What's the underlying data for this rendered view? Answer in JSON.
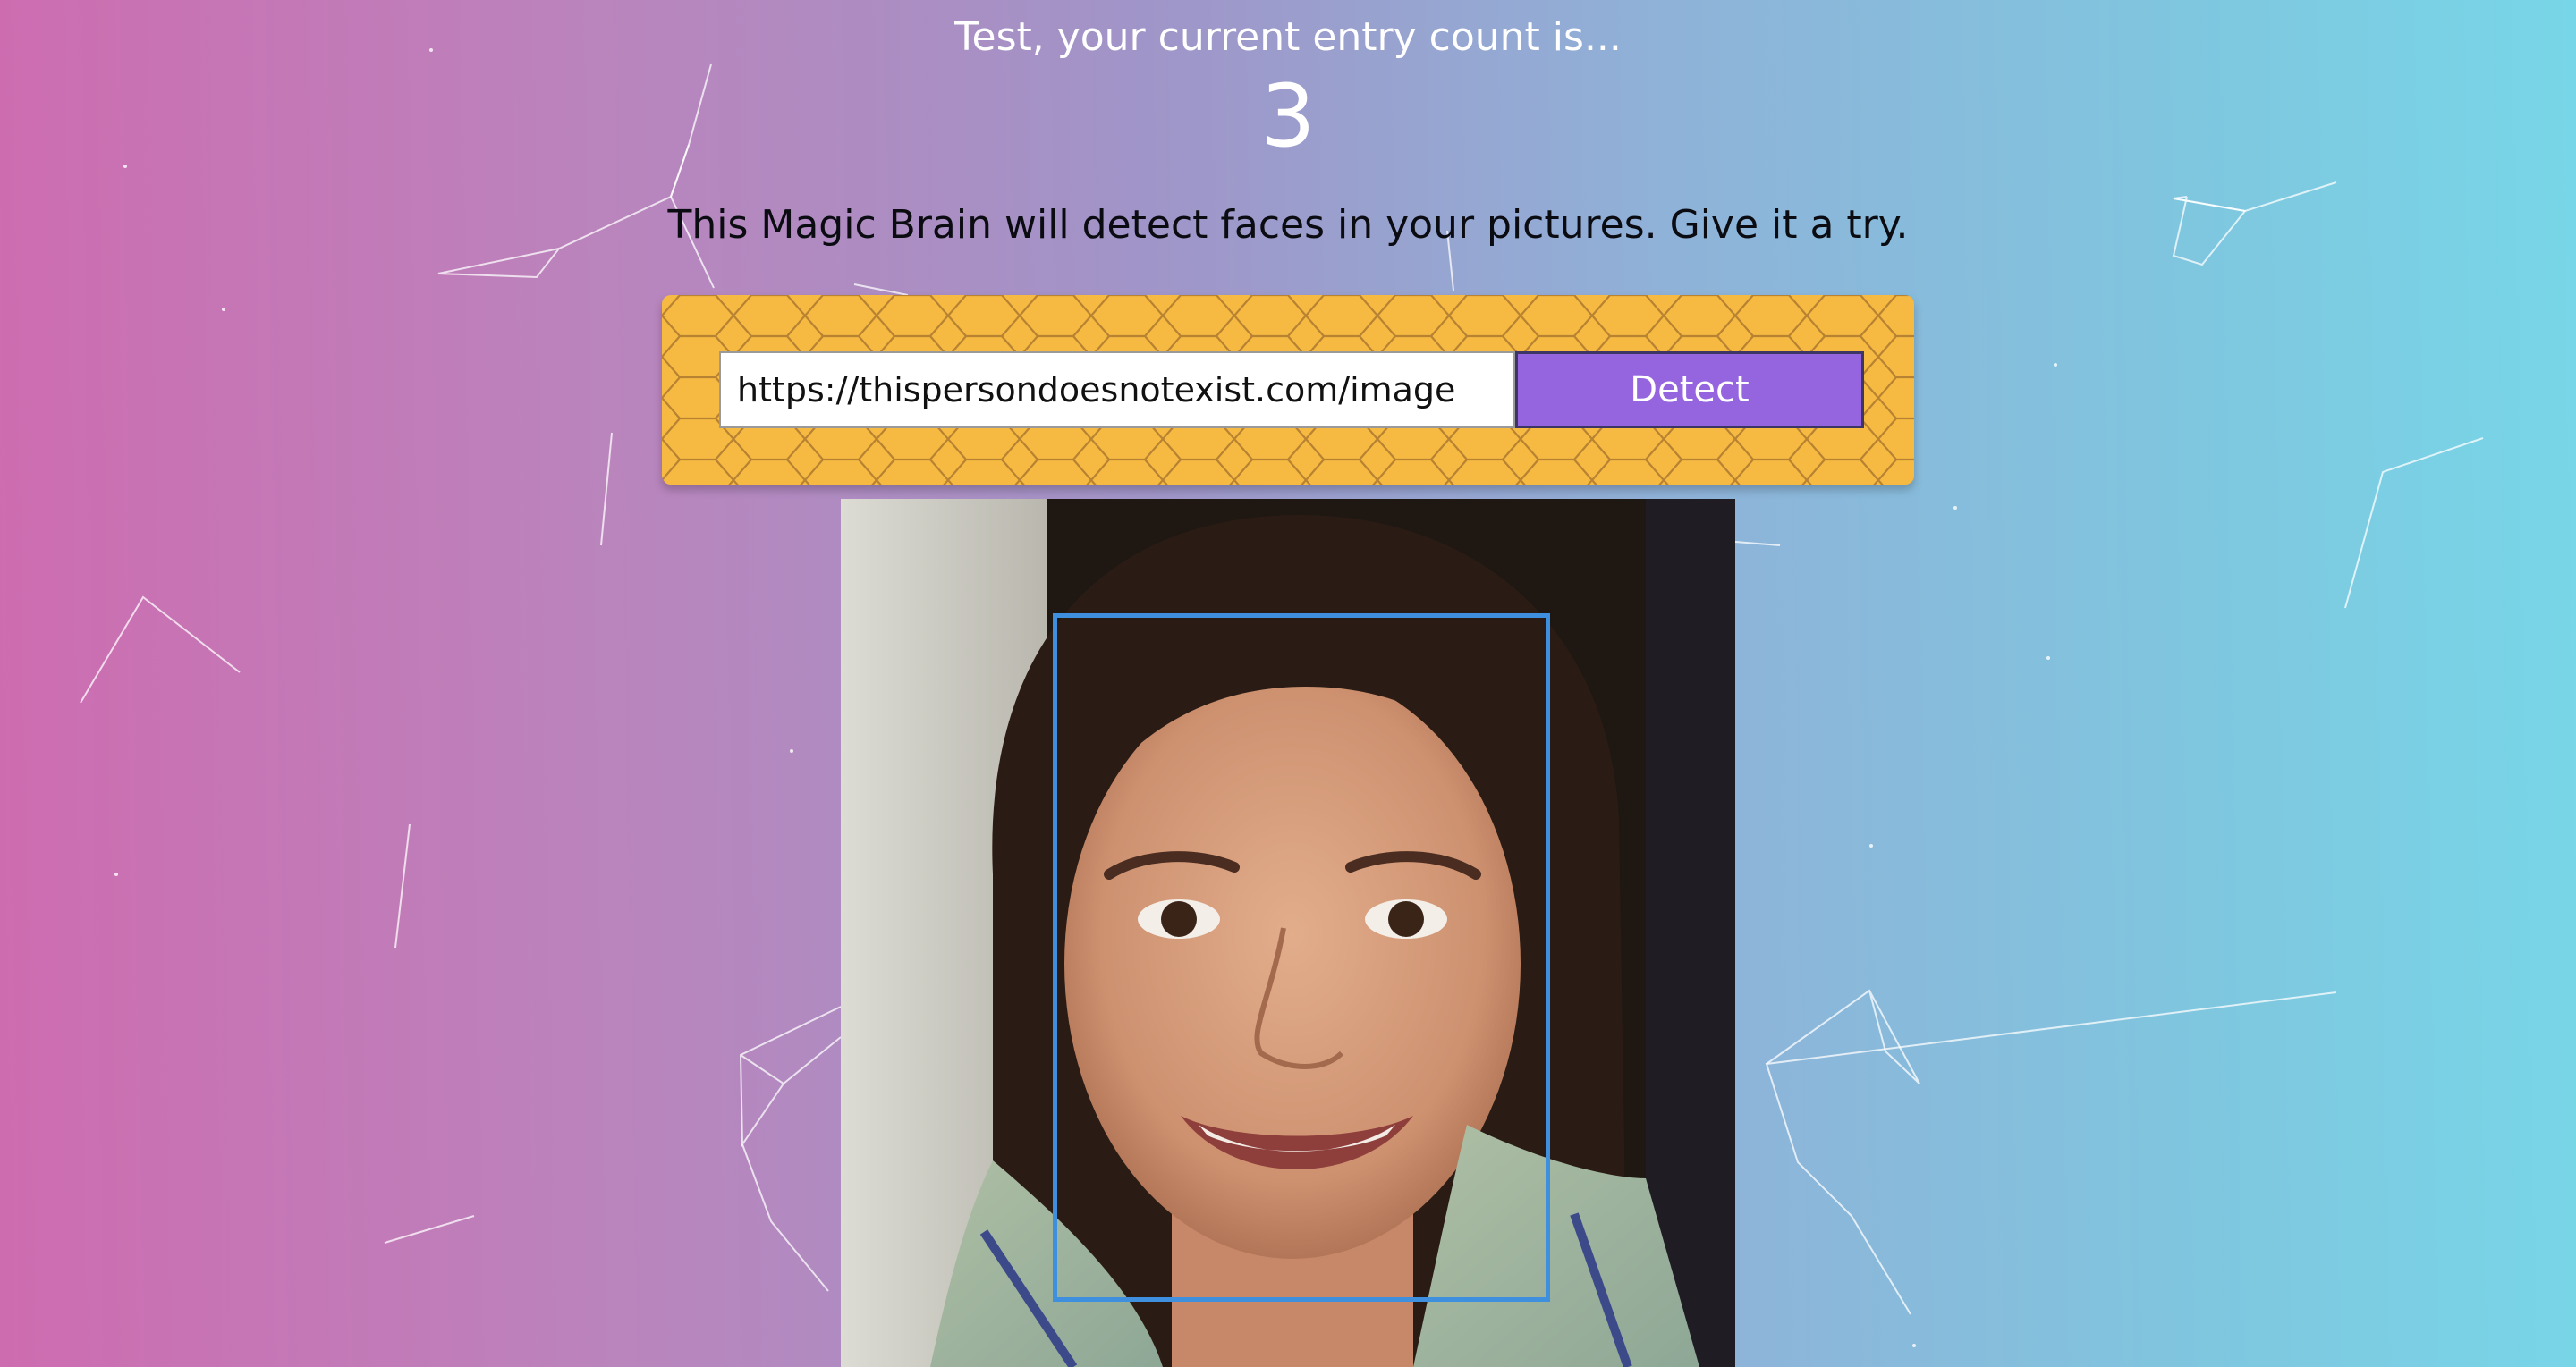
{
  "header": {
    "greeting": "Test, your current entry count is...",
    "entry_count": "3"
  },
  "tagline": "This Magic Brain will detect faces in your pictures. Give it a try.",
  "form": {
    "url_value": "https://thispersondoesnotexist.com/image",
    "detect_label": "Detect"
  },
  "result": {
    "faces_detected": 1
  },
  "colors": {
    "panel_background": "#f6b942",
    "button_background": "#9565e0",
    "face_box_border": "#3f8fdf",
    "gradient_left": "#ce6cb0",
    "gradient_right": "#77d6e7"
  }
}
